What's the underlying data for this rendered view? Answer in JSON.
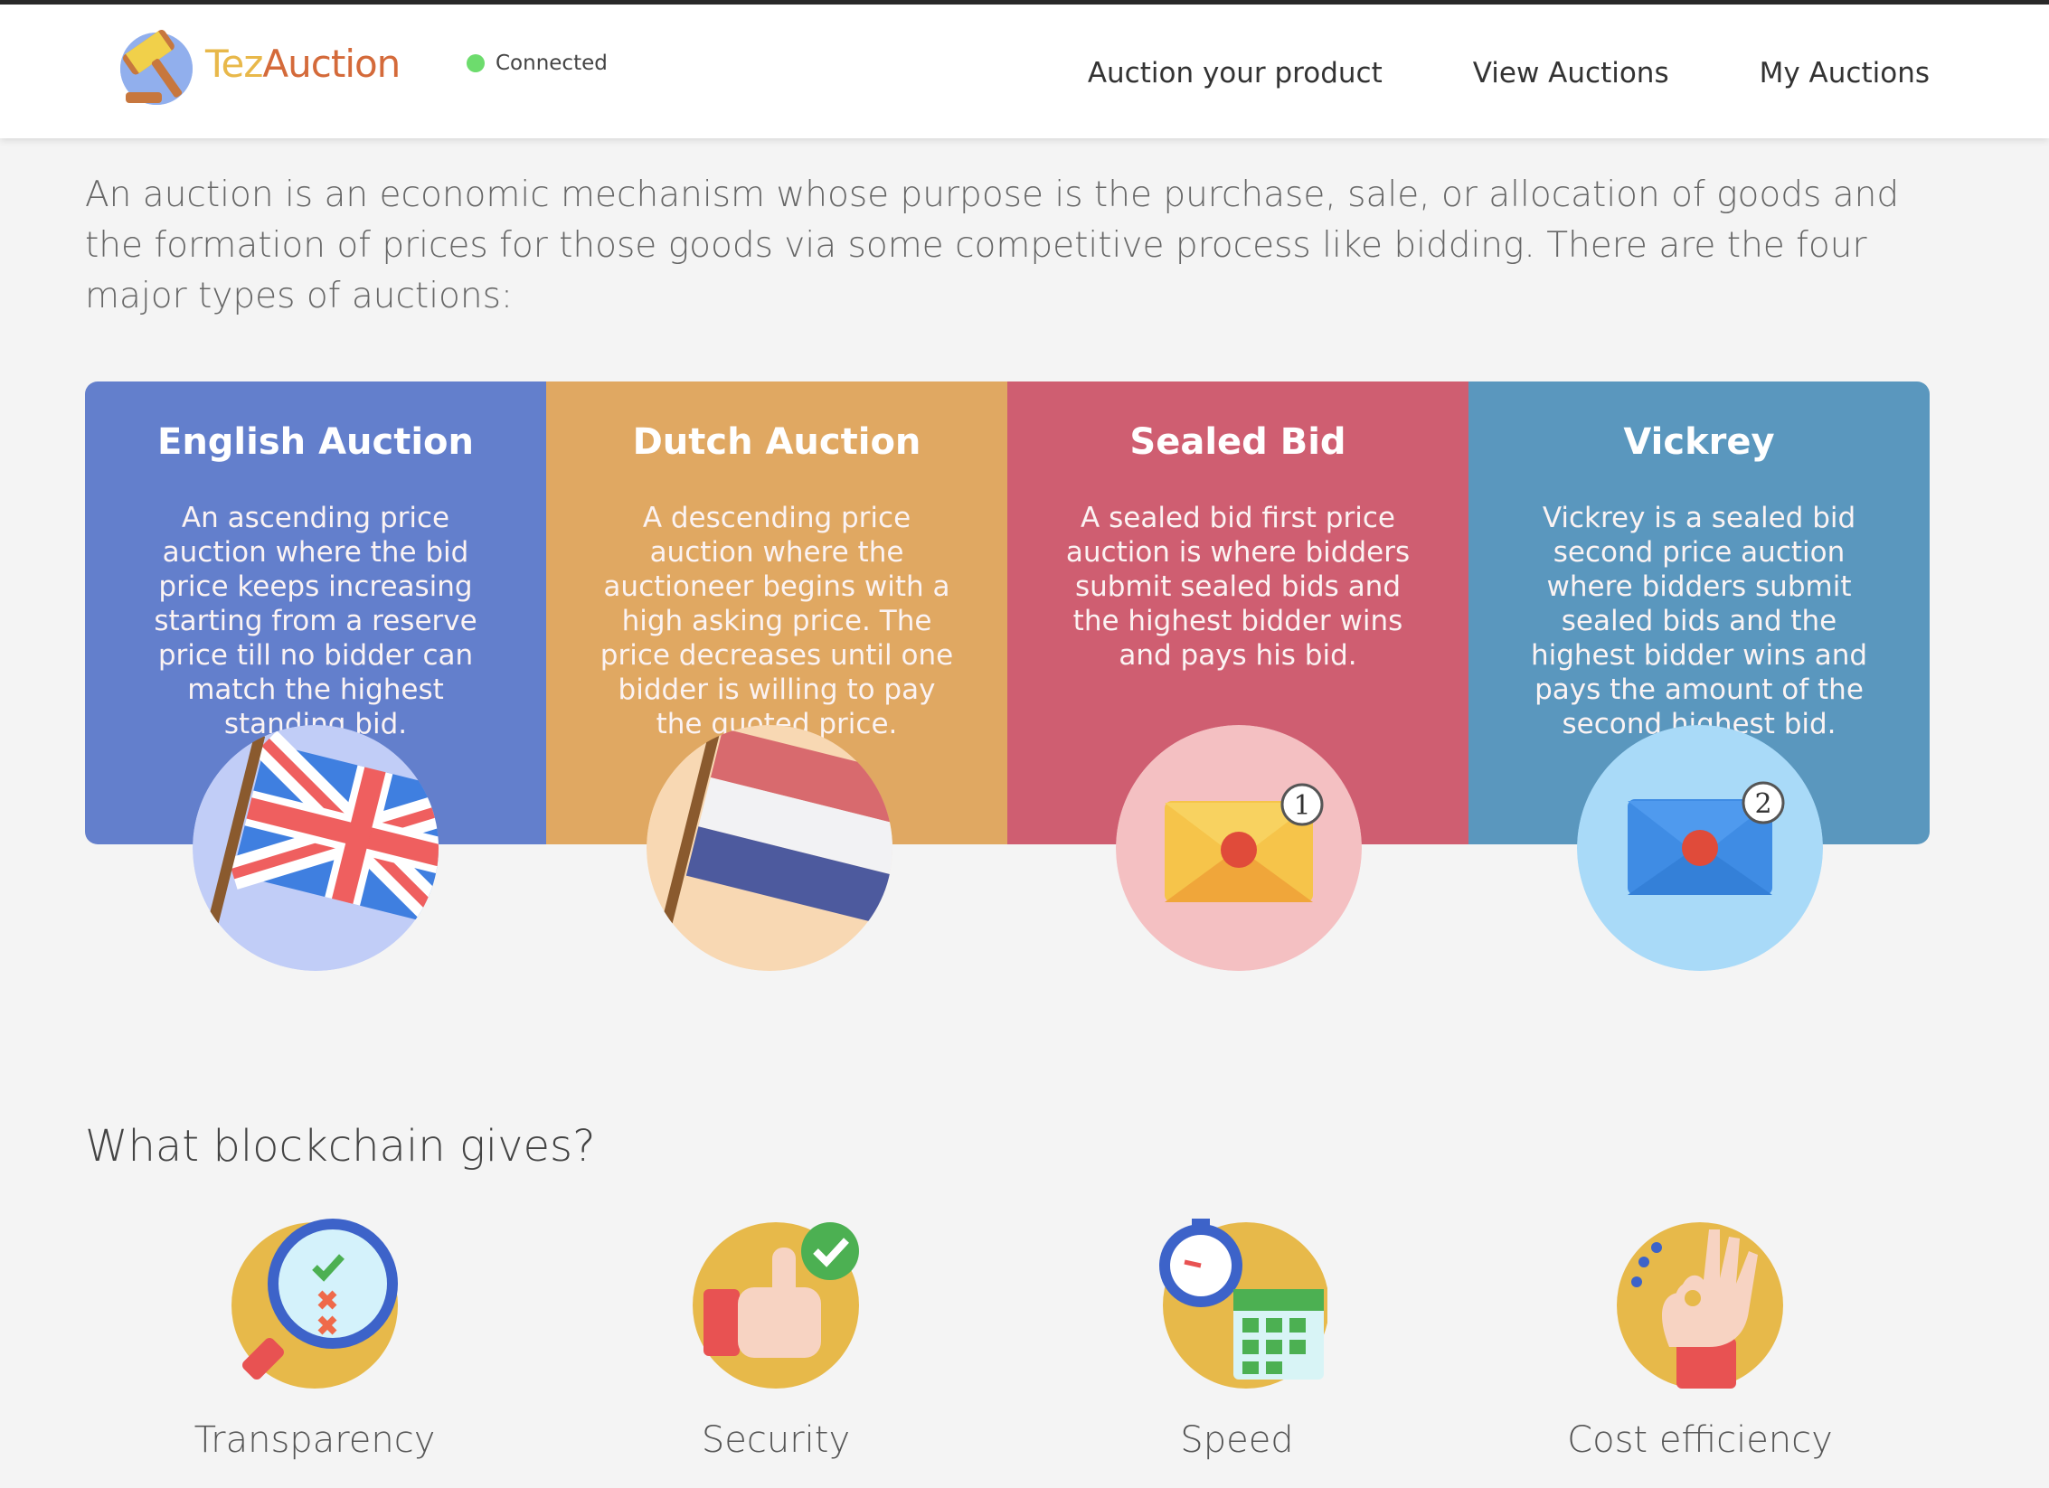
{
  "app": {
    "logo_text_part1": "Tez",
    "logo_text_part2": "Auction",
    "status_label": "Connected",
    "status_color": "#6ddc6d"
  },
  "nav": {
    "auction_product": "Auction your product",
    "view_auctions": "View Auctions",
    "my_auctions": "My Auctions"
  },
  "intro": "An auction is an economic mechanism whose purpose is the purchase, sale, or allocation of goods and the formation of prices for those goods via some competitive process like bidding. There are the four major types of auctions:",
  "auction_types": [
    {
      "title": "English Auction",
      "description": "An ascending price auction where the bid price keeps increasing starting from a reserve price till no bidder can match the highest standing bid.",
      "color": "#637fcc",
      "icon": "uk-flag-icon"
    },
    {
      "title": "Dutch Auction",
      "description": "A descending price auction where the auctioneer begins with a high asking price. The price decreases until one bidder is willing to pay the quoted price.",
      "color": "#e0a862",
      "icon": "netherlands-flag-icon"
    },
    {
      "title": "Sealed Bid",
      "description": "A sealed bid first price auction is where bidders submit sealed bids and the highest bidder wins and pays his bid.",
      "color": "#cf5e71",
      "icon": "sealed-envelope-first-icon",
      "badge": "1"
    },
    {
      "title": "Vickrey",
      "description": "Vickrey is a sealed bid second price auction where bidders submit sealed bids and the highest bidder wins and pays the amount of the second highest bid.",
      "color": "#5a97be",
      "icon": "sealed-envelope-second-icon",
      "badge": "2"
    }
  ],
  "benefits": {
    "title": "What blockchain gives?",
    "items": [
      {
        "label": "Transparency",
        "icon": "magnifier-check-icon"
      },
      {
        "label": "Security",
        "icon": "thumbs-up-check-icon"
      },
      {
        "label": "Speed",
        "icon": "stopwatch-calendar-icon"
      },
      {
        "label": "Cost efficiency",
        "icon": "ok-hand-icon"
      }
    ]
  }
}
